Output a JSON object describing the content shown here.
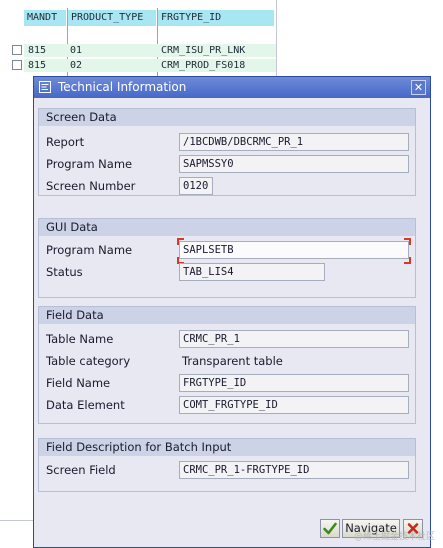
{
  "background_table": {
    "columns": [
      "MANDT",
      "PRODUCT_TYPE",
      "FRGTYPE_ID"
    ],
    "rows": [
      [
        "815",
        "01",
        "CRM_ISU_PR_LNK"
      ],
      [
        "815",
        "02",
        "CRM_PROD_FS018"
      ]
    ]
  },
  "dialog": {
    "title": "Technical Information",
    "title_icon": "edit-window-icon",
    "close_icon": "close-x-icon",
    "screen_data": {
      "title": "Screen Data",
      "report_label": "Report",
      "report_value": "/1BCDWB/DBCRMC_PR_1",
      "program_label": "Program Name",
      "program_value": "SAPMSSY0",
      "screen_number_label": "Screen Number",
      "screen_number_value": "0120"
    },
    "gui_data": {
      "title": "GUI Data",
      "program_label": "Program Name",
      "program_value": "SAPLSETB",
      "status_label": "Status",
      "status_value": "TAB_LIS4"
    },
    "field_data": {
      "title": "Field Data",
      "table_name_label": "Table Name",
      "table_name_value": "CRMC_PR_1",
      "table_category_label": "Table category",
      "table_category_value": "Transparent table",
      "field_name_label": "Field Name",
      "field_name_value": "FRGTYPE_ID",
      "data_element_label": "Data Element",
      "data_element_value": "COMT_FRGTYPE_ID"
    },
    "batch_input": {
      "title": "Field Description for Batch Input",
      "screen_field_label": "Screen Field",
      "screen_field_value": "CRMC_PR_1-FRGTYPE_ID"
    },
    "buttons": {
      "confirm_icon": "checkmark-icon",
      "navigate_label": "Navigate",
      "cancel_icon": "cancel-x-icon"
    }
  },
  "watermark": "@稀土掘金技术社区",
  "colors": {
    "title_bar": "#4a6cc9",
    "group_header": "#cdd3e6",
    "dialog_bg": "#e8e8f2",
    "table_header": "#a9e6f4",
    "row_highlight": "#e3f6ea",
    "focus_corner": "#d23a2c"
  }
}
